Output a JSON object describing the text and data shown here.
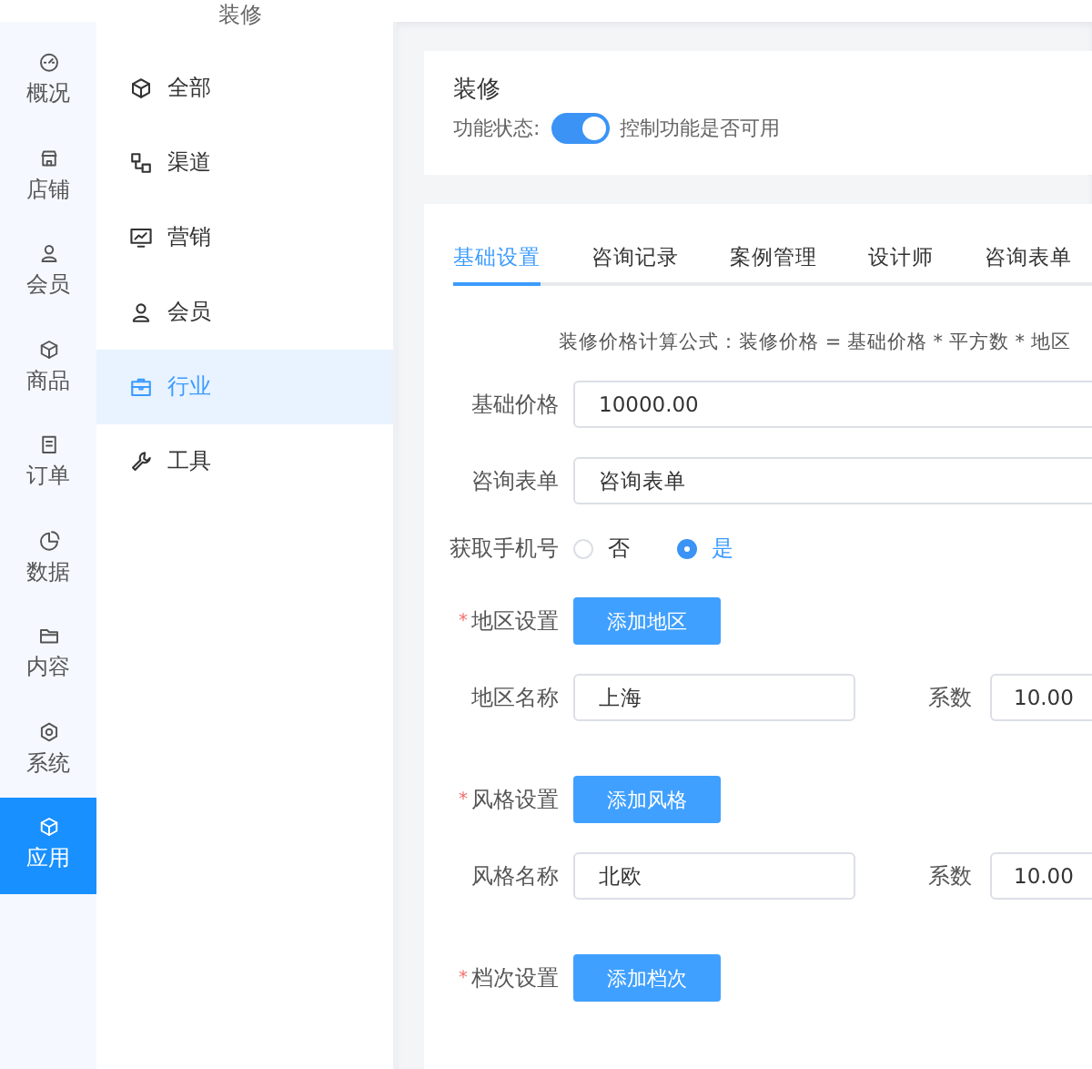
{
  "header": {
    "title": "装修"
  },
  "rail": [
    {
      "label": "概况",
      "selected": false
    },
    {
      "label": "店铺",
      "selected": false
    },
    {
      "label": "会员",
      "selected": false
    },
    {
      "label": "商品",
      "selected": false
    },
    {
      "label": "订单",
      "selected": false
    },
    {
      "label": "数据",
      "selected": false
    },
    {
      "label": "内容",
      "selected": false
    },
    {
      "label": "系统",
      "selected": false
    },
    {
      "label": "应用",
      "selected": true
    }
  ],
  "menu": [
    {
      "label": "全部",
      "selected": false
    },
    {
      "label": "渠道",
      "selected": false
    },
    {
      "label": "营销",
      "selected": false
    },
    {
      "label": "会员",
      "selected": false
    },
    {
      "label": "行业",
      "selected": true
    },
    {
      "label": "工具",
      "selected": false
    }
  ],
  "feature": {
    "title": "装修",
    "status_label": "功能状态:",
    "on": true,
    "hint": "控制功能是否可用"
  },
  "tabs": [
    {
      "label": "基础设置",
      "selected": true
    },
    {
      "label": "咨询记录",
      "selected": false
    },
    {
      "label": "案例管理",
      "selected": false
    },
    {
      "label": "设计师",
      "selected": false
    },
    {
      "label": "咨询表单",
      "selected": false
    }
  ],
  "formula": "装修价格计算公式：装修价格 = 基础价格 * 平方数 * 地区",
  "form": [
    {
      "kind": "input",
      "label": "基础价格",
      "value": "10000.00"
    },
    {
      "kind": "input",
      "label": "咨询表单",
      "value": "咨询表单"
    },
    {
      "kind": "radio",
      "label": "获取手机号",
      "options": [
        {
          "label": "否",
          "selected": false
        },
        {
          "label": "是",
          "selected": true
        }
      ]
    },
    {
      "kind": "button",
      "label": "地区设置",
      "required_mark": "*",
      "button": "添加地区"
    },
    {
      "kind": "pair",
      "label": "地区名称",
      "value": "上海",
      "factor_label": "系数",
      "factor_value": "10.00"
    },
    {
      "kind": "button",
      "label": "风格设置",
      "required_mark": "*",
      "button": "添加风格"
    },
    {
      "kind": "pair",
      "label": "风格名称",
      "value": "北欧",
      "factor_label": "系数",
      "factor_value": "10.00"
    },
    {
      "kind": "button",
      "label": "档次设置",
      "required_mark": "*",
      "button": "添加档次"
    }
  ]
}
